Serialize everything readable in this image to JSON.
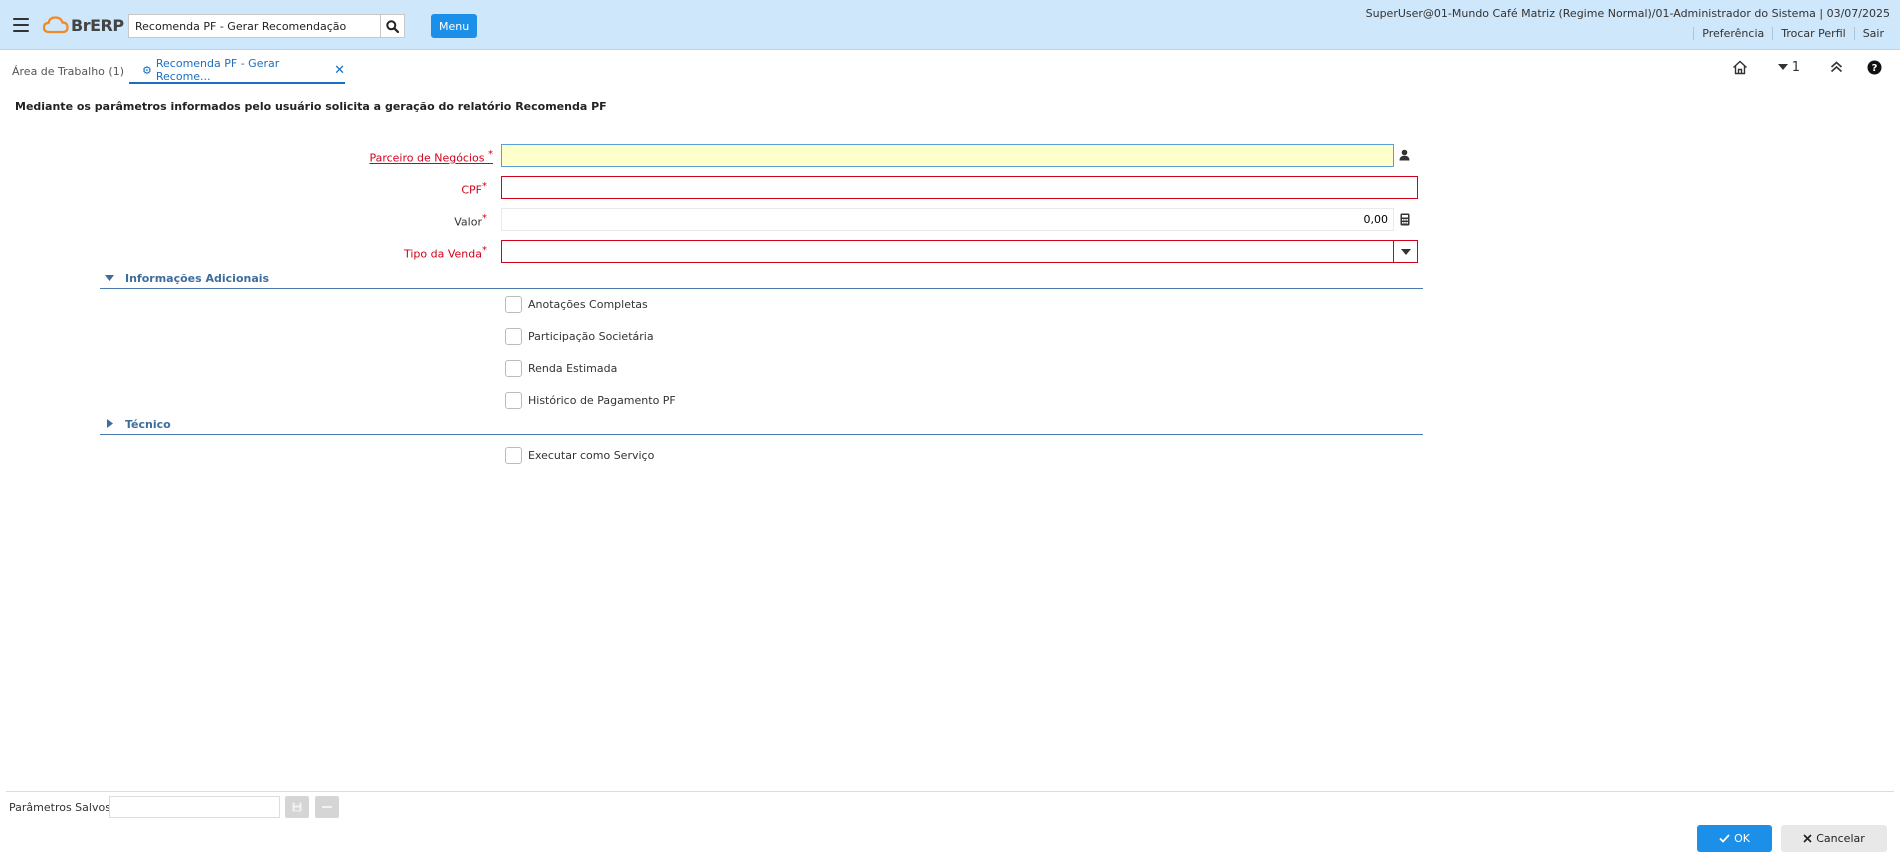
{
  "header": {
    "logo_text": "BrERP",
    "search_value": "Recomenda PF - Gerar Recomendação",
    "menu_label": "Menu",
    "user_info": "SuperUser@01-Mundo Café Matriz (Regime Normal)/01-Administrador do Sistema | 03/07/2025",
    "links": [
      "Preferência",
      "Trocar Perfil",
      "Sair"
    ]
  },
  "tabs": {
    "home": "Área de Trabalho (1)",
    "active": "Recomenda PF - Gerar Recome..."
  },
  "toolbar": {
    "counter": "1"
  },
  "description": "Mediante os parâmetros informados pelo usuário solicita a geração do relatório Recomenda PF",
  "form": {
    "fields": [
      {
        "label": "Parceiro de Negócios",
        "required_mark": "*",
        "value": ""
      },
      {
        "label": "CPF",
        "required_mark": "*",
        "value": ""
      },
      {
        "label": "Valor",
        "required_mark": "*",
        "value": "0,00"
      },
      {
        "label": "Tipo da Venda",
        "required_mark": "*",
        "value": ""
      }
    ],
    "sections": [
      {
        "title": "Informações Adicionais",
        "expanded": true,
        "checkboxes": [
          "Anotações Completas",
          "Participação Societária",
          "Renda Estimada",
          "Histórico de Pagamento PF"
        ]
      },
      {
        "title": "Técnico",
        "expanded": false,
        "checkboxes": [
          "Executar como Serviço"
        ]
      }
    ]
  },
  "footer": {
    "saved_params_label": "Parâmetros Salvos",
    "ok_label": "OK",
    "cancel_label": "Cancelar"
  },
  "colors": {
    "header_bg": "#cfe7fb",
    "accent": "#1c8fe8",
    "required": "#d0021b",
    "section": "#3e6d9c"
  }
}
